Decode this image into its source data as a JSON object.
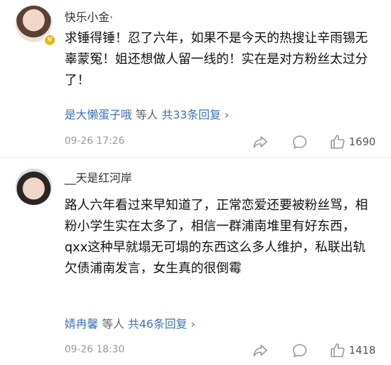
{
  "comments": [
    {
      "username": "快乐小金·",
      "verified_badge": "V",
      "text": "求锤得锤！忍了六年，如果不是今天的热搜让辛雨锡无辜蒙冤！姐还想做人留一线的！实在是对方粉丝太过分了！",
      "reply_user": "是大懒蛋子哦",
      "reply_mid": "等人",
      "reply_count": "共33条回复",
      "reply_arrow": "›",
      "time": "09-26 17:26",
      "likes": "1690",
      "icons": [
        "share-icon",
        "comment-icon",
        "like-icon"
      ]
    },
    {
      "username": "__天是红河岸",
      "text": "路人六年看过来早知道了，正常恋爱还要被粉丝骂，相粉小学生实在太多了，相信一群浦南堆里有好东西，qxx这种早就塌无可塌的东西这么多人维护，私联出轨欠债浦南发言，女生真的很倒霉",
      "reply_user": "婧冉馨",
      "reply_mid": "等人",
      "reply_count": "共46条回复",
      "reply_arrow": "›",
      "time": "09-26 18:30",
      "likes": "1418",
      "icons": [
        "share-icon",
        "comment-icon",
        "like-icon"
      ]
    }
  ],
  "colors": {
    "link": "#3c73b4",
    "meta": "#999999",
    "badge": "#f6b200"
  }
}
